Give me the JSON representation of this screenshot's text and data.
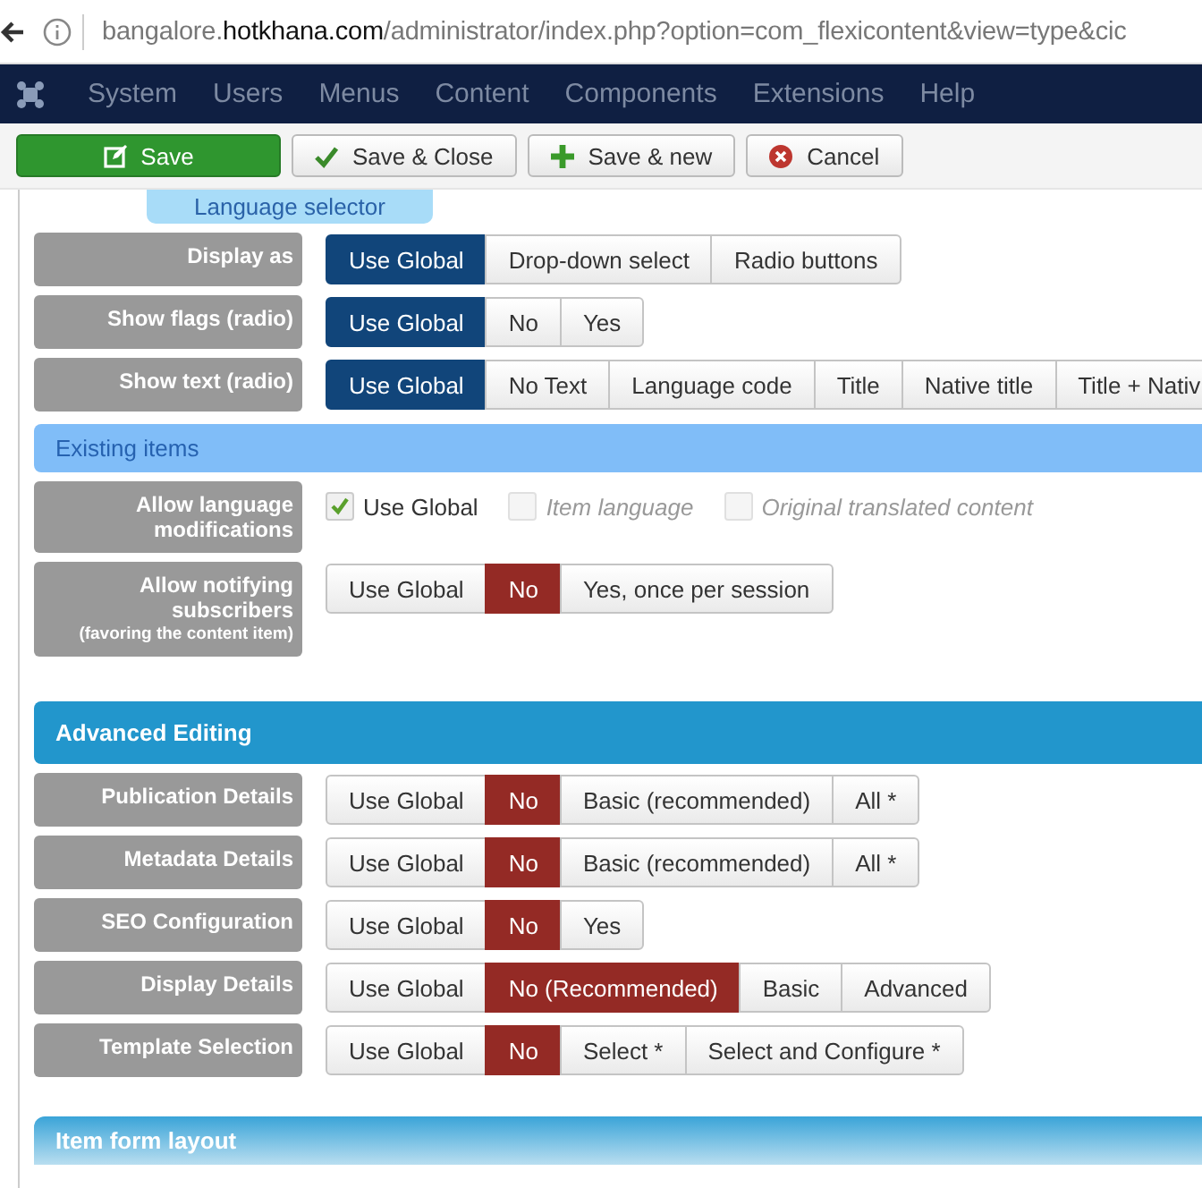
{
  "address_bar": {
    "url": "bangalore.**hotkhana.com**/administrator/index.php?option=com_flexicontent&view=type&cic"
  },
  "menu": [
    "System",
    "Users",
    "Menus",
    "Content",
    "Components",
    "Extensions",
    "Help"
  ],
  "toolbar": [
    {
      "label": "Save",
      "kind": "primary"
    },
    {
      "label": "Save & Close",
      "kind": "default"
    },
    {
      "label": "Save & new",
      "kind": "default"
    },
    {
      "label": "Cancel",
      "kind": "default"
    }
  ],
  "sections": [
    {
      "title": "Language selector",
      "kind": "tab",
      "fields": [
        {
          "label": "Display as",
          "kind": "primary-radio",
          "options": [
            {
              "label": "Use Global",
              "selected": true
            },
            {
              "label": "Drop-down select",
              "selected": false
            },
            {
              "label": "Radio buttons",
              "selected": false
            }
          ]
        },
        {
          "label": "Show flags (radio)",
          "kind": "primary-radio",
          "options": [
            {
              "label": "Use Global",
              "selected": true
            },
            {
              "label": "No",
              "selected": false
            },
            {
              "label": "Yes",
              "selected": false
            }
          ]
        },
        {
          "label": "Show text (radio)",
          "kind": "primary-radio",
          "options": [
            {
              "label": "Use Global",
              "selected": true
            },
            {
              "label": "No Text",
              "selected": false
            },
            {
              "label": "Language code",
              "selected": false
            },
            {
              "label": "Title",
              "selected": false
            },
            {
              "label": "Native title",
              "selected": false
            },
            {
              "label": "Title + Nativ",
              "selected": false
            }
          ]
        }
      ]
    },
    {
      "title": "Existing items",
      "kind": "light",
      "fields": [
        {
          "label": "Allow language modifications",
          "kind": "checkboxes",
          "options": [
            {
              "label": "Use Global",
              "checked": true,
              "disabled": false
            },
            {
              "label": "Item language",
              "checked": false,
              "disabled": true
            },
            {
              "label": "Original translated content",
              "checked": false,
              "disabled": true
            }
          ]
        },
        {
          "label": "Allow notifying subscribers",
          "note": "(favoring the content item)",
          "kind": "danger-radio",
          "options": [
            {
              "label": "Use Global",
              "selected": false
            },
            {
              "label": "No",
              "selected": true
            },
            {
              "label": "Yes, once per session",
              "selected": false
            }
          ]
        }
      ]
    },
    {
      "title": "Advanced Editing",
      "kind": "strong",
      "fields": [
        {
          "label": "Publication Details",
          "kind": "danger-radio",
          "options": [
            {
              "label": "Use Global",
              "selected": false
            },
            {
              "label": "No",
              "selected": true
            },
            {
              "label": "Basic (recommended)",
              "selected": false
            },
            {
              "label": "All *",
              "selected": false
            }
          ]
        },
        {
          "label": "Metadata Details",
          "kind": "danger-radio",
          "options": [
            {
              "label": "Use Global",
              "selected": false
            },
            {
              "label": "No",
              "selected": true
            },
            {
              "label": "Basic (recommended)",
              "selected": false
            },
            {
              "label": "All *",
              "selected": false
            }
          ]
        },
        {
          "label": "SEO Configuration",
          "kind": "danger-radio",
          "options": [
            {
              "label": "Use Global",
              "selected": false
            },
            {
              "label": "No",
              "selected": true
            },
            {
              "label": "Yes",
              "selected": false
            }
          ]
        },
        {
          "label": "Display Details",
          "kind": "danger-radio",
          "options": [
            {
              "label": "Use Global",
              "selected": false
            },
            {
              "label": "No (Recommended)",
              "selected": true
            },
            {
              "label": "Basic",
              "selected": false
            },
            {
              "label": "Advanced",
              "selected": false
            }
          ]
        },
        {
          "label": "Template Selection",
          "kind": "danger-radio",
          "options": [
            {
              "label": "Use Global",
              "selected": false
            },
            {
              "label": "No",
              "selected": true
            },
            {
              "label": "Select *",
              "selected": false
            },
            {
              "label": "Select and Configure *",
              "selected": false
            }
          ]
        }
      ]
    },
    {
      "title": "Item form layout",
      "kind": "gradient"
    }
  ]
}
